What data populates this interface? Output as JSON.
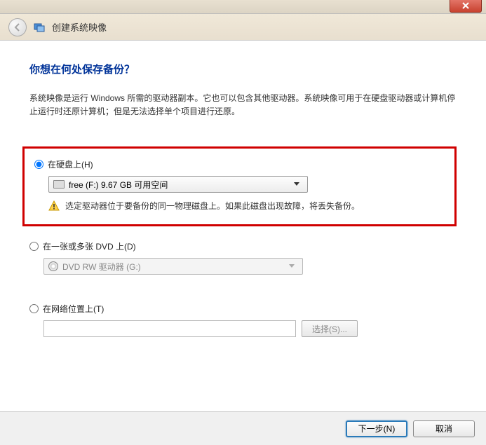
{
  "window": {
    "close_label": "X"
  },
  "header": {
    "title": "创建系统映像"
  },
  "main": {
    "heading": "你想在何处保存备份？",
    "description": "系统映像是运行 Windows 所需的驱动器副本。它也可以包含其他驱动器。系统映像可用于在硬盘驱动器或计算机停止运行时还原计算机；但是无法选择单个项目进行还原。"
  },
  "options": {
    "hard_disk": {
      "label": "在硬盘上(H)",
      "selected": "free (F:)  9.67 GB 可用空间",
      "warning": "选定驱动器位于要备份的同一物理磁盘上。如果此磁盘出现故障，将丢失备份。"
    },
    "dvd": {
      "label": "在一张或多张 DVD 上(D)",
      "selected": "DVD RW 驱动器 (G:)"
    },
    "network": {
      "label": "在网络位置上(T)",
      "value": "",
      "browse_label": "选择(S)..."
    }
  },
  "footer": {
    "next_label": "下一步(N)",
    "cancel_label": "取消"
  }
}
